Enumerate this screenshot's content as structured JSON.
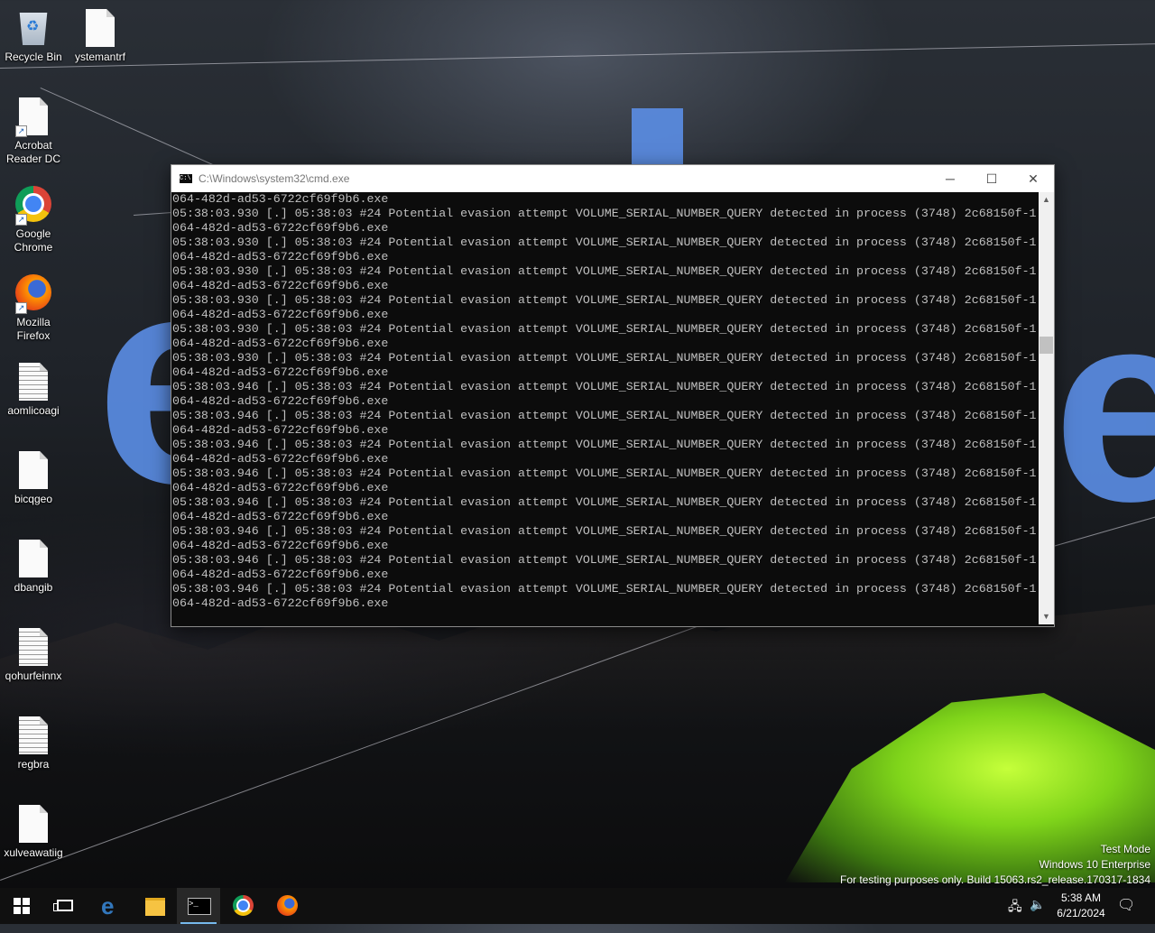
{
  "desktop": {
    "icons": [
      {
        "label": "Recycle Bin",
        "icon": "recycle-bin-icon"
      },
      {
        "label": "ystemantrf",
        "icon": "file-icon"
      },
      {
        "label": "Acrobat Reader DC",
        "icon": "file-shortcut-icon"
      },
      {
        "label": "Google Chrome",
        "icon": "chrome-icon"
      },
      {
        "label": "Mozilla Firefox",
        "icon": "firefox-icon"
      },
      {
        "label": "aomlicoagi",
        "icon": "text-file-icon"
      },
      {
        "label": "bicqgeo",
        "icon": "file-icon"
      },
      {
        "label": "dbangib",
        "icon": "file-icon"
      },
      {
        "label": "qohurfeinnx",
        "icon": "text-file-icon"
      },
      {
        "label": "regbra",
        "icon": "text-file-icon"
      },
      {
        "label": "xulveawatiig",
        "icon": "file-icon"
      }
    ]
  },
  "cmd_window": {
    "title": "C:\\Windows\\system32\\cmd.exe",
    "icon_text": "C:\\",
    "minimize": "─",
    "maximize": "☐",
    "close": "✕",
    "console_text": "064-482d-ad53-6722cf69f9b6.exe\n05:38:03.930 [.] 05:38:03 #24 Potential evasion attempt VOLUME_SERIAL_NUMBER_QUERY detected in process (3748) 2c68150f-1\n064-482d-ad53-6722cf69f9b6.exe\n05:38:03.930 [.] 05:38:03 #24 Potential evasion attempt VOLUME_SERIAL_NUMBER_QUERY detected in process (3748) 2c68150f-1\n064-482d-ad53-6722cf69f9b6.exe\n05:38:03.930 [.] 05:38:03 #24 Potential evasion attempt VOLUME_SERIAL_NUMBER_QUERY detected in process (3748) 2c68150f-1\n064-482d-ad53-6722cf69f9b6.exe\n05:38:03.930 [.] 05:38:03 #24 Potential evasion attempt VOLUME_SERIAL_NUMBER_QUERY detected in process (3748) 2c68150f-1\n064-482d-ad53-6722cf69f9b6.exe\n05:38:03.930 [.] 05:38:03 #24 Potential evasion attempt VOLUME_SERIAL_NUMBER_QUERY detected in process (3748) 2c68150f-1\n064-482d-ad53-6722cf69f9b6.exe\n05:38:03.930 [.] 05:38:03 #24 Potential evasion attempt VOLUME_SERIAL_NUMBER_QUERY detected in process (3748) 2c68150f-1\n064-482d-ad53-6722cf69f9b6.exe\n05:38:03.946 [.] 05:38:03 #24 Potential evasion attempt VOLUME_SERIAL_NUMBER_QUERY detected in process (3748) 2c68150f-1\n064-482d-ad53-6722cf69f9b6.exe\n05:38:03.946 [.] 05:38:03 #24 Potential evasion attempt VOLUME_SERIAL_NUMBER_QUERY detected in process (3748) 2c68150f-1\n064-482d-ad53-6722cf69f9b6.exe\n05:38:03.946 [.] 05:38:03 #24 Potential evasion attempt VOLUME_SERIAL_NUMBER_QUERY detected in process (3748) 2c68150f-1\n064-482d-ad53-6722cf69f9b6.exe\n05:38:03.946 [.] 05:38:03 #24 Potential evasion attempt VOLUME_SERIAL_NUMBER_QUERY detected in process (3748) 2c68150f-1\n064-482d-ad53-6722cf69f9b6.exe\n05:38:03.946 [.] 05:38:03 #24 Potential evasion attempt VOLUME_SERIAL_NUMBER_QUERY detected in process (3748) 2c68150f-1\n064-482d-ad53-6722cf69f9b6.exe\n05:38:03.946 [.] 05:38:03 #24 Potential evasion attempt VOLUME_SERIAL_NUMBER_QUERY detected in process (3748) 2c68150f-1\n064-482d-ad53-6722cf69f9b6.exe\n05:38:03.946 [.] 05:38:03 #24 Potential evasion attempt VOLUME_SERIAL_NUMBER_QUERY detected in process (3748) 2c68150f-1\n064-482d-ad53-6722cf69f9b6.exe\n05:38:03.946 [.] 05:38:03 #24 Potential evasion attempt VOLUME_SERIAL_NUMBER_QUERY detected in process (3748) 2c68150f-1\n064-482d-ad53-6722cf69f9b6.exe"
  },
  "watermark": {
    "line1": "Test Mode",
    "line2": "Windows 10 Enterprise",
    "line3": "For testing purposes only. Build 15063.rs2_release.170317-1834"
  },
  "taskbar": {
    "items": [
      {
        "name": "start",
        "icon": "windows-logo-icon"
      },
      {
        "name": "task-view",
        "icon": "task-view-icon"
      },
      {
        "name": "edge",
        "icon": "edge-icon",
        "glyph": "e"
      },
      {
        "name": "file-explorer",
        "icon": "folder-icon"
      },
      {
        "name": "cmd",
        "icon": "cmd-icon",
        "glyph": ">_"
      },
      {
        "name": "chrome",
        "icon": "chrome-icon"
      },
      {
        "name": "firefox",
        "icon": "firefox-icon"
      }
    ],
    "tray": {
      "network_glyph": "🖧",
      "volume_glyph": "🔈",
      "time": "5:38 AM",
      "date": "6/21/2024",
      "notification_glyph": "🗨"
    }
  },
  "colors": {
    "console_bg": "#0c0c0c",
    "console_text": "#c0c0c0",
    "taskbar_bg": "#101010",
    "accent": "#76b9ed"
  }
}
